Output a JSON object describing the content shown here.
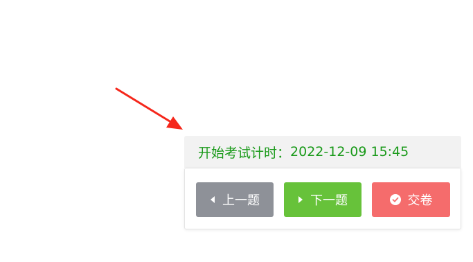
{
  "timer": {
    "label": "开始考试计时：",
    "value": "2022-12-09 15:45"
  },
  "buttons": {
    "prev": {
      "label": "上一题",
      "icon": "caret-left-icon",
      "color": "#8e9198"
    },
    "next": {
      "label": "下一题",
      "icon": "caret-right-icon",
      "color": "#67c23a"
    },
    "submit": {
      "label": "交卷",
      "icon": "check-circle-icon",
      "color": "#f56c6c"
    }
  },
  "annotation": {
    "icon": "red-arrow-icon",
    "color": "#f5271b"
  }
}
